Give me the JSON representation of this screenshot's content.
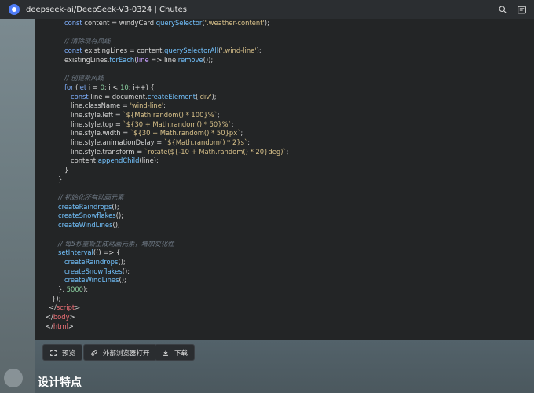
{
  "window": {
    "title": "deepseek-ai/DeepSeek-V3-0324 | Chutes"
  },
  "code": {
    "lines": [
      {
        "indent": 6,
        "parts": [
          {
            "t": "const",
            "c": "kw"
          },
          {
            "t": " content = windyCard.",
            "c": "op"
          },
          {
            "t": "querySelector",
            "c": "fn"
          },
          {
            "t": "(",
            "c": "op"
          },
          {
            "t": "'.weather-content'",
            "c": "str"
          },
          {
            "t": ");",
            "c": "op"
          }
        ]
      },
      {
        "indent": 0,
        "parts": []
      },
      {
        "indent": 6,
        "parts": [
          {
            "t": "// 清除现有风线",
            "c": "cm"
          }
        ]
      },
      {
        "indent": 6,
        "parts": [
          {
            "t": "const",
            "c": "kw"
          },
          {
            "t": " existingLines = content.",
            "c": "op"
          },
          {
            "t": "querySelectorAll",
            "c": "fn"
          },
          {
            "t": "(",
            "c": "op"
          },
          {
            "t": "'.wind-line'",
            "c": "str"
          },
          {
            "t": ");",
            "c": "op"
          }
        ]
      },
      {
        "indent": 6,
        "parts": [
          {
            "t": "existingLines.",
            "c": "op"
          },
          {
            "t": "forEach",
            "c": "fn"
          },
          {
            "t": "(",
            "c": "op"
          },
          {
            "t": "line",
            "c": "var"
          },
          {
            "t": " => line.",
            "c": "op"
          },
          {
            "t": "remove",
            "c": "fn"
          },
          {
            "t": "());",
            "c": "op"
          }
        ]
      },
      {
        "indent": 0,
        "parts": []
      },
      {
        "indent": 6,
        "parts": [
          {
            "t": "// 创建新风线",
            "c": "cm"
          }
        ]
      },
      {
        "indent": 6,
        "parts": [
          {
            "t": "for",
            "c": "kw"
          },
          {
            "t": " (",
            "c": "op"
          },
          {
            "t": "let",
            "c": "kw"
          },
          {
            "t": " i = ",
            "c": "op"
          },
          {
            "t": "0",
            "c": "num"
          },
          {
            "t": "; i < ",
            "c": "op"
          },
          {
            "t": "10",
            "c": "num"
          },
          {
            "t": "; i++) {",
            "c": "op"
          }
        ]
      },
      {
        "indent": 8,
        "parts": [
          {
            "t": "const",
            "c": "kw"
          },
          {
            "t": " line = document.",
            "c": "op"
          },
          {
            "t": "createElement",
            "c": "fn"
          },
          {
            "t": "(",
            "c": "op"
          },
          {
            "t": "'div'",
            "c": "str"
          },
          {
            "t": ");",
            "c": "op"
          }
        ]
      },
      {
        "indent": 8,
        "parts": [
          {
            "t": "line.className = ",
            "c": "op"
          },
          {
            "t": "'wind-line'",
            "c": "str"
          },
          {
            "t": ";",
            "c": "op"
          }
        ]
      },
      {
        "indent": 8,
        "parts": [
          {
            "t": "line.style.left = ",
            "c": "op"
          },
          {
            "t": "`${Math.random() * 100}%`",
            "c": "str"
          },
          {
            "t": ";",
            "c": "op"
          }
        ]
      },
      {
        "indent": 8,
        "parts": [
          {
            "t": "line.style.top = ",
            "c": "op"
          },
          {
            "t": "`${30 + Math.random() * 50}%`",
            "c": "str"
          },
          {
            "t": ";",
            "c": "op"
          }
        ]
      },
      {
        "indent": 8,
        "parts": [
          {
            "t": "line.style.width = ",
            "c": "op"
          },
          {
            "t": "`${30 + Math.random() * 50}px`",
            "c": "str"
          },
          {
            "t": ";",
            "c": "op"
          }
        ]
      },
      {
        "indent": 8,
        "parts": [
          {
            "t": "line.style.animationDelay = ",
            "c": "op"
          },
          {
            "t": "`${Math.random() * 2}s`",
            "c": "str"
          },
          {
            "t": ";",
            "c": "op"
          }
        ]
      },
      {
        "indent": 8,
        "parts": [
          {
            "t": "line.style.transform = ",
            "c": "op"
          },
          {
            "t": "`rotate(${-10 + Math.random() * 20}deg)`",
            "c": "str"
          },
          {
            "t": ";",
            "c": "op"
          }
        ]
      },
      {
        "indent": 8,
        "parts": [
          {
            "t": "content.",
            "c": "op"
          },
          {
            "t": "appendChild",
            "c": "fn"
          },
          {
            "t": "(line);",
            "c": "op"
          }
        ]
      },
      {
        "indent": 6,
        "parts": [
          {
            "t": "}",
            "c": "op"
          }
        ]
      },
      {
        "indent": 4,
        "parts": [
          {
            "t": "}",
            "c": "op"
          }
        ]
      },
      {
        "indent": 0,
        "parts": []
      },
      {
        "indent": 4,
        "parts": [
          {
            "t": "// 初始化所有动画元素",
            "c": "cm"
          }
        ]
      },
      {
        "indent": 4,
        "parts": [
          {
            "t": "createRaindrops",
            "c": "fn"
          },
          {
            "t": "();",
            "c": "op"
          }
        ]
      },
      {
        "indent": 4,
        "parts": [
          {
            "t": "createSnowflakes",
            "c": "fn"
          },
          {
            "t": "();",
            "c": "op"
          }
        ]
      },
      {
        "indent": 4,
        "parts": [
          {
            "t": "createWindLines",
            "c": "fn"
          },
          {
            "t": "();",
            "c": "op"
          }
        ]
      },
      {
        "indent": 0,
        "parts": []
      },
      {
        "indent": 4,
        "parts": [
          {
            "t": "// 每5秒重新生成动画元素，增加变化性",
            "c": "cm"
          }
        ]
      },
      {
        "indent": 4,
        "parts": [
          {
            "t": "setInterval",
            "c": "fn"
          },
          {
            "t": "(() => {",
            "c": "op"
          }
        ]
      },
      {
        "indent": 6,
        "parts": [
          {
            "t": "createRaindrops",
            "c": "fn"
          },
          {
            "t": "();",
            "c": "op"
          }
        ]
      },
      {
        "indent": 6,
        "parts": [
          {
            "t": "createSnowflakes",
            "c": "fn"
          },
          {
            "t": "();",
            "c": "op"
          }
        ]
      },
      {
        "indent": 6,
        "parts": [
          {
            "t": "createWindLines",
            "c": "fn"
          },
          {
            "t": "();",
            "c": "op"
          }
        ]
      },
      {
        "indent": 4,
        "parts": [
          {
            "t": "}, ",
            "c": "op"
          },
          {
            "t": "5000",
            "c": "num"
          },
          {
            "t": ");",
            "c": "op"
          }
        ]
      },
      {
        "indent": 2,
        "parts": [
          {
            "t": "});",
            "c": "op"
          }
        ]
      },
      {
        "indent": 1,
        "parts": [
          {
            "t": "</",
            "c": "op"
          },
          {
            "t": "script",
            "c": "tag"
          },
          {
            "t": ">",
            "c": "op"
          }
        ]
      },
      {
        "indent": 0,
        "parts": [
          {
            "t": "</",
            "c": "op"
          },
          {
            "t": "body",
            "c": "tag"
          },
          {
            "t": ">",
            "c": "op"
          }
        ]
      },
      {
        "indent": 0,
        "parts": [
          {
            "t": "</",
            "c": "op"
          },
          {
            "t": "html",
            "c": "tag"
          },
          {
            "t": ">",
            "c": "op"
          }
        ]
      }
    ]
  },
  "buttons": {
    "preview": "预览",
    "open_external": "外部浏览器打开",
    "download": "下载"
  },
  "section": {
    "title": "设计特点"
  },
  "icons": {
    "app": "deepseek-logo-icon",
    "search": "search-icon",
    "window": "window-icon",
    "preview": "expand-icon",
    "external": "link-icon",
    "download": "download-icon"
  }
}
